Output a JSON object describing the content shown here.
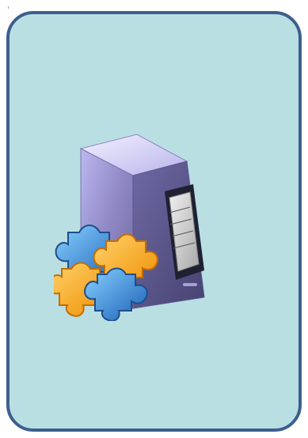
{
  "card": {
    "background": "#b9dfe3",
    "border_color": "#3d5f8e"
  },
  "illustration": {
    "icon": "server-with-puzzle-pieces",
    "colors": {
      "tower": "#8e88c6",
      "tower_dark": "#5d5891",
      "puzzle_blue": "#2f79d2",
      "puzzle_orange": "#f3a417"
    }
  }
}
